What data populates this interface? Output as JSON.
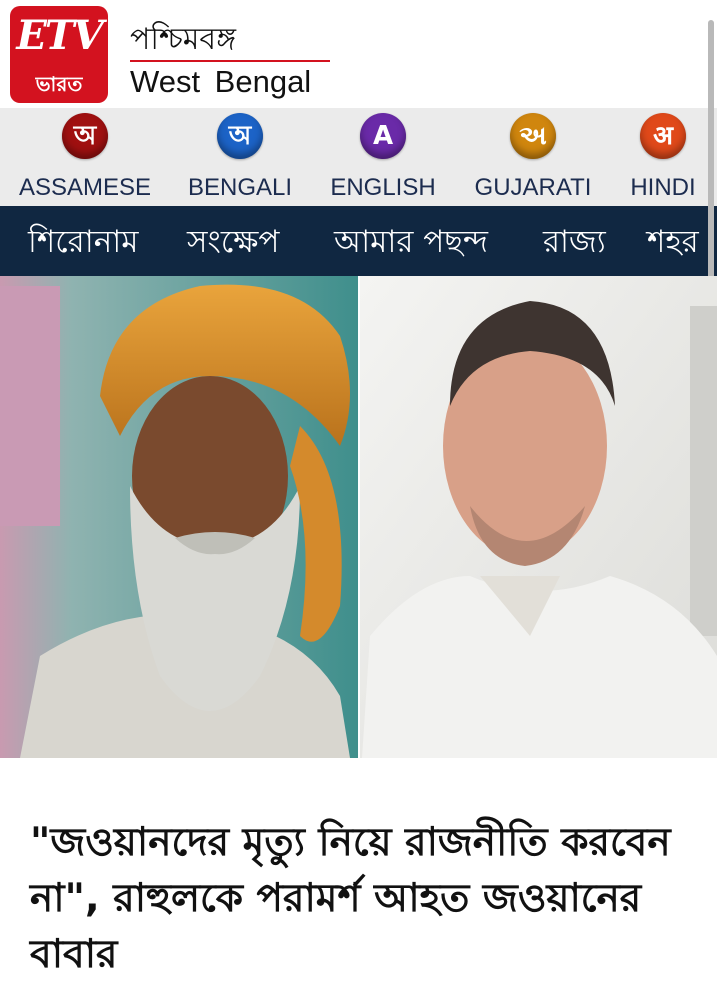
{
  "brand": {
    "logo_text": "ETV",
    "logo_sub": "ভারত"
  },
  "region": {
    "bengali": "পশ্চিমবঙ্গ",
    "english": "West  Bengal"
  },
  "languages": [
    {
      "glyph": "অ",
      "label": "ASSAMESE",
      "color": "#a01010"
    },
    {
      "glyph": "অ",
      "label": "BENGALI",
      "color": "#1c63c7"
    },
    {
      "glyph": "A",
      "label": "ENGLISH",
      "color": "#6a2aa8"
    },
    {
      "glyph": "અ",
      "label": "GUJARATI",
      "color": "#d0860e"
    },
    {
      "glyph": "अ",
      "label": "HINDI",
      "color": "#e0491a"
    }
  ],
  "categories": [
    "শিরোনাম",
    "সংক্ষেপ",
    "আমার পছন্দ",
    "রাজ্য",
    "শহর"
  ],
  "article": {
    "headline": "\"জওয়ানদের মৃত্যু নিয়ে রাজনীতি করবেন না\", রাহুলকে পরামর্শ আহত জওয়ানের বাবার"
  }
}
